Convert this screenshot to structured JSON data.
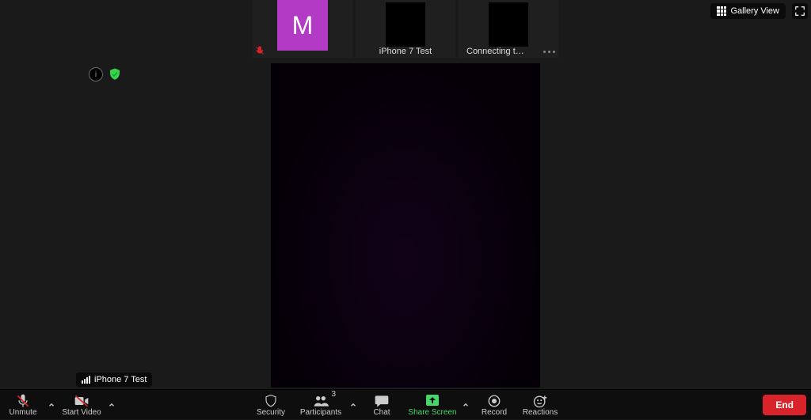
{
  "top": {
    "view_button": "Gallery View"
  },
  "thumbnails": [
    {
      "initial": "M",
      "label": "",
      "muted": true,
      "kind": "avatar"
    },
    {
      "label": "iPhone 7 Test",
      "kind": "black"
    },
    {
      "label": "Connecting t…",
      "kind": "black",
      "loading": true
    }
  ],
  "speaker": "iPhone 7 Test",
  "toolbar": {
    "unmute": "Unmute",
    "start_video": "Start Video",
    "security": "Security",
    "participants": "Participants",
    "participants_count": "3",
    "chat": "Chat",
    "share": "Share Screen",
    "record": "Record",
    "reactions": "Reactions",
    "end": "End"
  }
}
